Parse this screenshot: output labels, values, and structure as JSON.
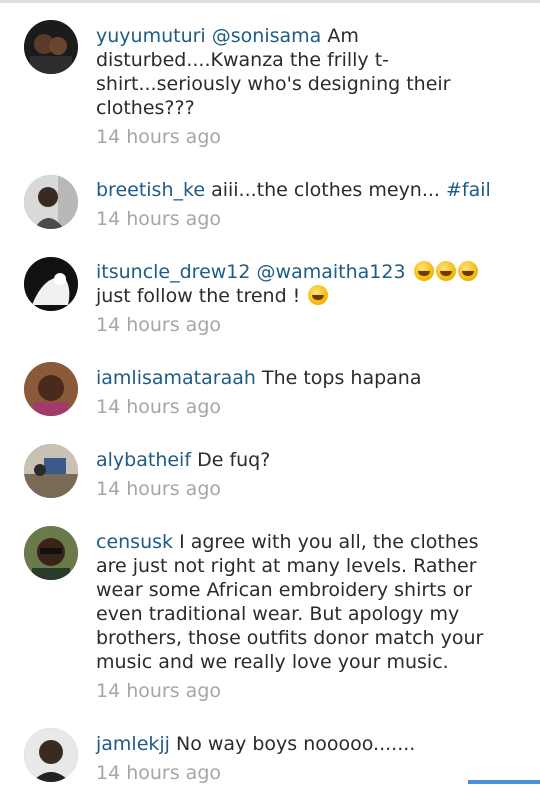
{
  "comments": [
    {
      "username": "yuyumuturi",
      "mention": "@sonisama",
      "text": "Am disturbed....Kwanza the frilly t-shirt...seriously who's designing their clothes???",
      "time": "14 hours ago"
    },
    {
      "username": "breetish_ke",
      "text": "aiii...the clothes meyn...",
      "hashtag": "#fail",
      "time": "14 hours ago"
    },
    {
      "username": "itsuncle_drew12",
      "mention": "@wamaitha123",
      "text": "just follow the trend !",
      "time": "14 hours ago"
    },
    {
      "username": "iamlisamataraah",
      "text": "The tops hapana",
      "time": "14 hours ago"
    },
    {
      "username": "alybatheif",
      "text": "De fuq?",
      "time": "14 hours ago"
    },
    {
      "username": "censusk",
      "text": "I agree with you all, the clothes are just not right at many levels. Rather wear some African embroidery shirts or even traditional wear. But apology my brothers, those outfits donor match your music and we really love your music.",
      "time": "14 hours ago"
    },
    {
      "username": "jamlekjj",
      "text": "No way boys nooooo.......",
      "time": "14 hours ago"
    }
  ],
  "icons": {
    "emoji": "laughing-emoji-icon"
  },
  "colors": {
    "username": "#1f5b87",
    "timestamp": "#a6a6a6",
    "body_text": "#2b2b2b",
    "accent": "#4a90d9"
  }
}
